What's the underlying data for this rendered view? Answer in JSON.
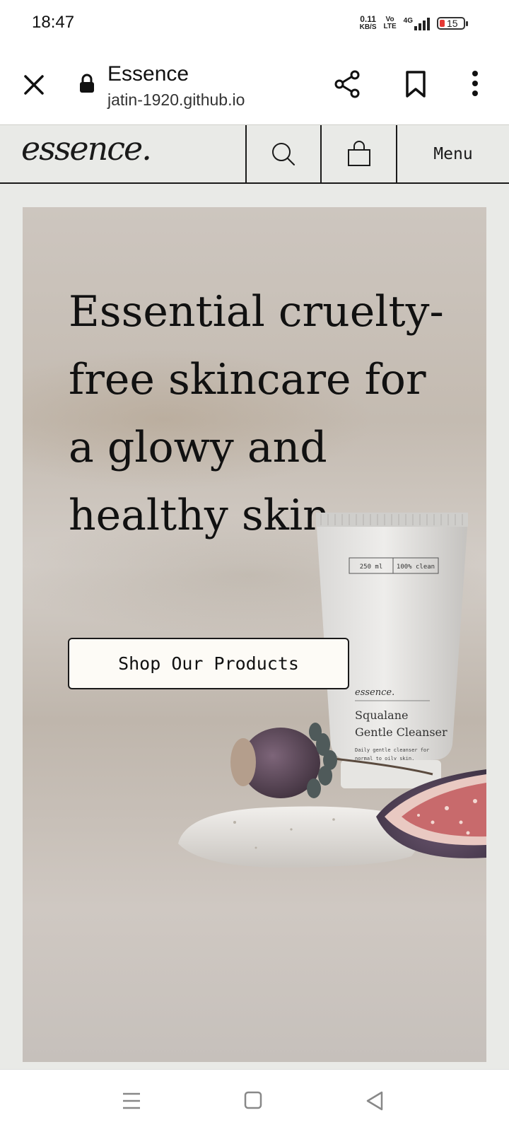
{
  "status_bar": {
    "time": "18:47",
    "net_speed_value": "0.11",
    "net_speed_unit": "KB/S",
    "volte_line1": "Vo",
    "volte_line2": "LTE",
    "network": "4G",
    "battery": "15"
  },
  "browser": {
    "title": "Essence",
    "url": "jatin-1920.github.io"
  },
  "site_header": {
    "logo": "essence.",
    "menu_label": "Menu"
  },
  "hero": {
    "heading": "Essential cruelty-free skincare for a glowy and healthy skin.",
    "cta_label": "Shop Our Products",
    "product": {
      "volume": "250 ml",
      "claim": "100% clean",
      "brand": "essence.",
      "name_line1": "Squalane",
      "name_line2": "Gentle Cleanser",
      "desc_line1": "Daily gentle cleanser for",
      "desc_line2": "normal to oily skin."
    }
  },
  "colors": {
    "page_bg": "#e9eae7",
    "button_bg": "#fdfbf6",
    "ink": "#1a1a1a"
  }
}
